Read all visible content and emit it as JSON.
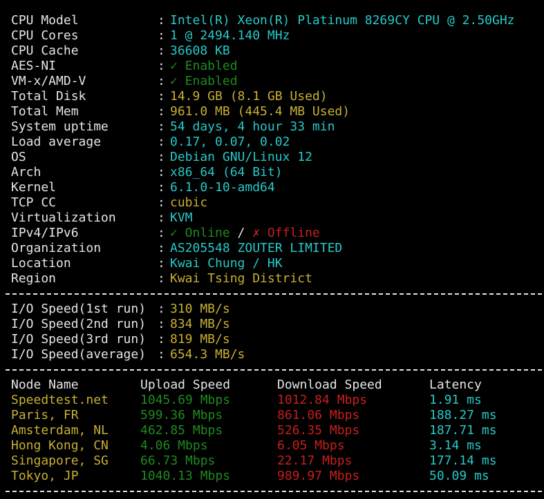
{
  "sysinfo": [
    {
      "key": "CPU Model",
      "value": "Intel(R) Xeon(R) Platinum 8269CY CPU @ 2.50GHz",
      "color": "cyan"
    },
    {
      "key": "CPU Cores",
      "value": "1 @ 2494.140 MHz",
      "color": "cyan"
    },
    {
      "key": "CPU Cache",
      "value": "36608 KB",
      "color": "cyan"
    },
    {
      "key": "AES-NI",
      "value": "✓ Enabled",
      "color": "green"
    },
    {
      "key": "VM-x/AMD-V",
      "value": "✓ Enabled",
      "color": "green"
    },
    {
      "key": "Total Disk",
      "value": "14.9 GB (8.1 GB Used)",
      "color": "yellow"
    },
    {
      "key": "Total Mem",
      "value": "961.0 MB (445.4 MB Used)",
      "color": "yellow"
    },
    {
      "key": "System uptime",
      "value": "54 days, 4 hour 33 min",
      "color": "cyan"
    },
    {
      "key": "Load average",
      "value": "0.17, 0.07, 0.02",
      "color": "cyan"
    },
    {
      "key": "OS",
      "value": "Debian GNU/Linux 12",
      "color": "cyan"
    },
    {
      "key": "Arch",
      "value": "x86_64 (64 Bit)",
      "color": "cyan"
    },
    {
      "key": "Kernel",
      "value": "6.1.0-10-amd64",
      "color": "cyan"
    },
    {
      "key": "TCP CC",
      "value": "cubic",
      "color": "yellow"
    },
    {
      "key": "Virtualization",
      "value": "KVM",
      "color": "cyan"
    }
  ],
  "ipv": {
    "key": "IPv4/IPv6",
    "online": "✓ Online",
    "slash": " / ",
    "offline": "✗ Offline"
  },
  "location_info": [
    {
      "key": "Organization",
      "value": "AS205548 ZOUTER LIMITED",
      "color": "cyan"
    },
    {
      "key": "Location",
      "value": "Kwai Chung / HK",
      "color": "cyan"
    },
    {
      "key": "Region",
      "value": "Kwai Tsing District",
      "color": "yellow"
    }
  ],
  "separator": ": ",
  "io": [
    {
      "key": "I/O Speed(1st run)",
      "value": "310 MB/s"
    },
    {
      "key": "I/O Speed(2nd run)",
      "value": "834 MB/s"
    },
    {
      "key": "I/O Speed(3rd run)",
      "value": "819 MB/s"
    },
    {
      "key": "I/O Speed(average)",
      "value": "654.3 MB/s"
    }
  ],
  "speedtest": {
    "headers": [
      "Node Name",
      "Upload Speed",
      "Download Speed",
      "Latency"
    ],
    "rows": [
      {
        "node": "Speedtest.net",
        "upload": "1045.69 Mbps",
        "download": "1012.84 Mbps",
        "latency": "1.91 ms"
      },
      {
        "node": "Paris, FR",
        "upload": "599.36 Mbps",
        "download": "861.06 Mbps",
        "latency": "188.27 ms"
      },
      {
        "node": "Amsterdam, NL",
        "upload": "462.85 Mbps",
        "download": "526.35 Mbps",
        "latency": "187.71 ms"
      },
      {
        "node": "Hong Kong, CN",
        "upload": "4.06 Mbps",
        "download": "6.05 Mbps",
        "latency": "3.14 ms"
      },
      {
        "node": "Singapore, SG",
        "upload": "66.73 Mbps",
        "download": "22.17 Mbps",
        "latency": "177.14 ms"
      },
      {
        "node": "Tokyo, JP",
        "upload": "1040.13 Mbps",
        "download": "989.97 Mbps",
        "latency": "50.09 ms"
      }
    ]
  },
  "colors": {
    "background": "#000000",
    "label": "#e6e6e6",
    "cyan": "#27c9c9",
    "yellow": "#c8b032",
    "green": "#1f8a1f",
    "red": "#c81e1e"
  }
}
